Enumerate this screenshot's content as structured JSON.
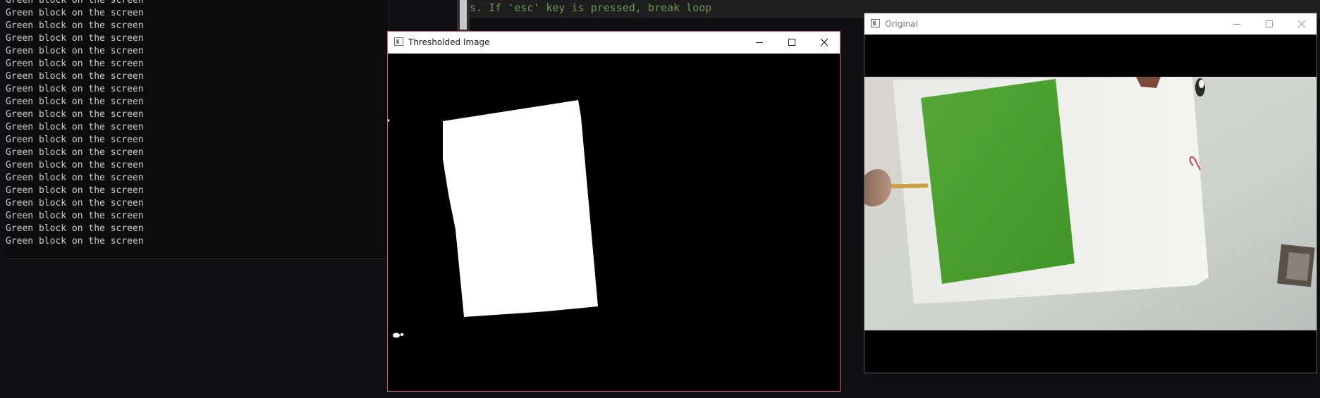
{
  "console": {
    "lines": [
      "Green block on the screen",
      "Green block on the screen",
      "Green block on the screen",
      "Green block on the screen",
      "Green block on the screen",
      "Green block on the screen",
      "Green block on the screen",
      "Green block on the screen",
      "Green block on the screen",
      "Green block on the screen",
      "Green block on the screen",
      "Green block on the screen",
      "Green block on the screen",
      "Green block on the screen",
      "Green block on the screen",
      "Green block on the screen",
      "Green block on the screen",
      "Green block on the screen",
      "Green block on the screen",
      "Green block on the screen"
    ]
  },
  "editor": {
    "code_comment": "s. If 'esc' key is pressed, break loop"
  },
  "thresholded_window": {
    "title": "Thresholded Image"
  },
  "original_window": {
    "title": "Original"
  },
  "colors": {
    "accent_border": "#d0617e",
    "green_block": "#4ea02e",
    "comment_green": "#6a9955"
  }
}
